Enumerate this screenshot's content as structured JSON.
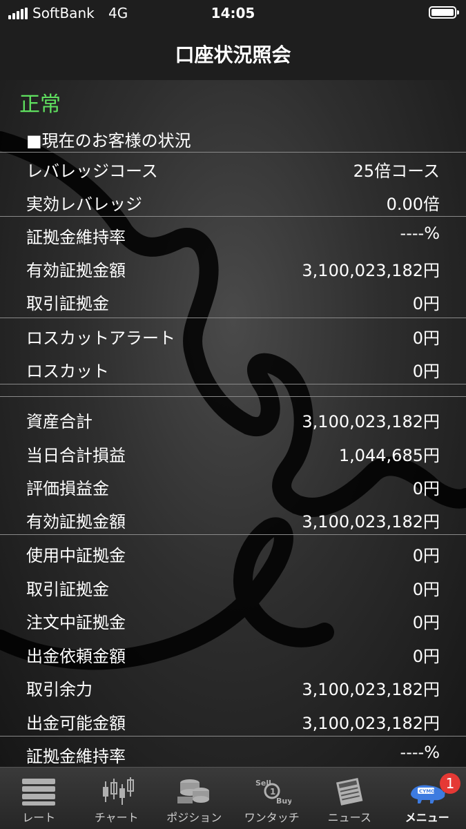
{
  "status_bar": {
    "carrier": "SoftBank",
    "network": "4G",
    "time": "14:05"
  },
  "header": {
    "title": "口座状況照会"
  },
  "account": {
    "status": "正常",
    "status_color": "#5fe05f",
    "section_title": "■現在のお客様の状況",
    "rows": [
      {
        "label": "レバレッジコース",
        "value": "25倍コース"
      },
      {
        "label": "実効レバレッジ",
        "value": "0.00倍"
      },
      {
        "label": "証拠金維持率",
        "value": "----%"
      },
      {
        "label": "有効証拠金額",
        "value": "3,100,023,182円"
      },
      {
        "label": "取引証拠金",
        "value": "0円"
      },
      {
        "label": "ロスカットアラート",
        "value": "0円"
      },
      {
        "label": "ロスカット",
        "value": "0円"
      },
      {
        "label": "資産合計",
        "value": "3,100,023,182円"
      },
      {
        "label": "当日合計損益",
        "value": "1,044,685円"
      },
      {
        "label": "評価損益金",
        "value": "0円"
      },
      {
        "label": "有効証拠金額",
        "value": "3,100,023,182円"
      },
      {
        "label": "使用中証拠金",
        "value": "0円"
      },
      {
        "label": "取引証拠金",
        "value": "0円"
      },
      {
        "label": "注文中証拠金",
        "value": "0円"
      },
      {
        "label": "出金依頼金額",
        "value": "0円"
      },
      {
        "label": "取引余力",
        "value": "3,100,023,182円"
      },
      {
        "label": "出金可能金額",
        "value": "3,100,023,182円"
      },
      {
        "label": "証拠金維持率",
        "value": "----%"
      }
    ]
  },
  "tabbar": {
    "tabs": [
      {
        "label": "レート",
        "icon": "rate-list-icon"
      },
      {
        "label": "チャート",
        "icon": "candlestick-chart-icon"
      },
      {
        "label": "ポジション",
        "icon": "coins-icon"
      },
      {
        "label": "ワンタッチ",
        "icon": "sell-buy-icon"
      },
      {
        "label": "ニュース",
        "icon": "newspaper-icon"
      },
      {
        "label": "メニュー",
        "icon": "cymo-rhino-icon"
      }
    ],
    "active_tab": "メニュー",
    "menu_badge": "1",
    "badge_color": "#e53935"
  }
}
